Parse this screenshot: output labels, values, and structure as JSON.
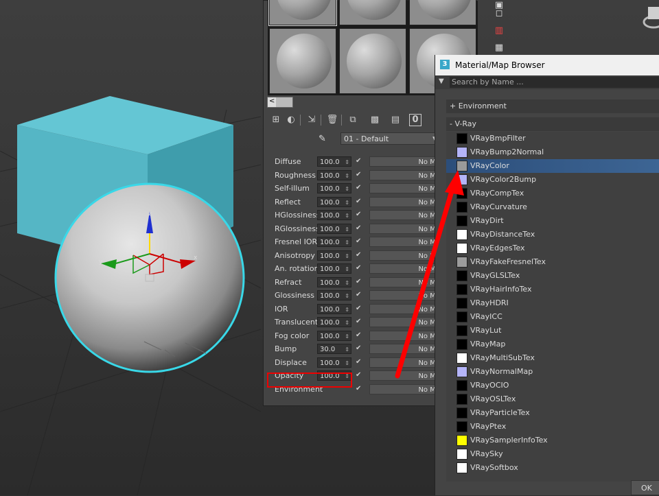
{
  "material_editor": {
    "toolbar_icons": [
      "get-material-icon",
      "put-to-scene-icon",
      "assign-material-icon",
      "delete-icon",
      "make-unique-icon",
      "show-in-viewport-icon",
      "save-icon",
      "material-id-channel-icon"
    ],
    "material_id_channel": "0",
    "nav_left": "<",
    "material_name": "01 - Default",
    "maps": [
      {
        "label": "Diffuse",
        "value": "100.0",
        "slot": "No Ma"
      },
      {
        "label": "Roughness",
        "value": "100.0",
        "slot": "No Ma"
      },
      {
        "label": "Self-illum",
        "value": "100.0",
        "slot": "No Ma"
      },
      {
        "label": "Reflect",
        "value": "100.0",
        "slot": "No Ma"
      },
      {
        "label": "HGlossiness",
        "value": "100.0",
        "slot": "No Ma"
      },
      {
        "label": "RGlossiness",
        "value": "100.0",
        "slot": "No Ma"
      },
      {
        "label": "Fresnel IOR",
        "value": "100.0",
        "slot": "No Ma"
      },
      {
        "label": "Anisotropy",
        "value": "100.0",
        "slot": "No Ma"
      },
      {
        "label": "An. rotation",
        "value": "100.0",
        "slot": "No Ma"
      },
      {
        "label": "Refract",
        "value": "100.0",
        "slot": "No Ma"
      },
      {
        "label": "Glossiness",
        "value": "100.0",
        "slot": "No Ma"
      },
      {
        "label": "IOR",
        "value": "100.0",
        "slot": "No Ma"
      },
      {
        "label": "Translucent",
        "value": "100.0",
        "slot": "No Ma"
      },
      {
        "label": "Fog color",
        "value": "100.0",
        "slot": "No Ma"
      },
      {
        "label": "Bump",
        "value": "30.0",
        "slot": "No Ma"
      },
      {
        "label": "Displace",
        "value": "100.0",
        "slot": "No Ma"
      },
      {
        "label": "Opacity",
        "value": "100.0",
        "slot": "No Ma"
      },
      {
        "label": "Environment",
        "value": "",
        "slot": "No Ma"
      }
    ]
  },
  "browser": {
    "title": "Material/Map Browser",
    "search_placeholder": "Search by Name ...",
    "groups": {
      "environment": "+ Environment",
      "vray": "- V-Ray"
    },
    "items": [
      {
        "name": "VRayBmpFilter",
        "color": "#000000"
      },
      {
        "name": "VRayBump2Normal",
        "color": "#b4b4f8"
      },
      {
        "name": "VRayColor",
        "color": "#9a9a9a"
      },
      {
        "name": "VRayColor2Bump",
        "color": "#b4b4f8"
      },
      {
        "name": "VRayCompTex",
        "color": "#000000"
      },
      {
        "name": "VRayCurvature",
        "color": "#000000"
      },
      {
        "name": "VRayDirt",
        "color": "#000000"
      },
      {
        "name": "VRayDistanceTex",
        "color": "#ffffff"
      },
      {
        "name": "VRayEdgesTex",
        "color": "#ffffff"
      },
      {
        "name": "VRayFakeFresnelTex",
        "color": "#9c9c9c"
      },
      {
        "name": "VRayGLSLTex",
        "color": "#000000"
      },
      {
        "name": "VRayHairInfoTex",
        "color": "#000000"
      },
      {
        "name": "VRayHDRI",
        "color": "#000000"
      },
      {
        "name": "VRayICC",
        "color": "#000000"
      },
      {
        "name": "VRayLut",
        "color": "#000000"
      },
      {
        "name": "VRayMap",
        "color": "#000000"
      },
      {
        "name": "VRayMultiSubTex",
        "color": "#ffffff"
      },
      {
        "name": "VRayNormalMap",
        "color": "#b4b4f8"
      },
      {
        "name": "VRayOCIO",
        "color": "#000000"
      },
      {
        "name": "VRayOSLTex",
        "color": "#000000"
      },
      {
        "name": "VRayParticleTex",
        "color": "#000000"
      },
      {
        "name": "VRayPtex",
        "color": "#000000"
      },
      {
        "name": "VRaySamplerInfoTex",
        "color": "#ffff00"
      },
      {
        "name": "VRaySky",
        "color": "#ffffff"
      },
      {
        "name": "VRaySoftbox",
        "color": "#ffffff"
      }
    ],
    "selected_item": "VRayColor",
    "ok_label": "OK"
  },
  "gizmo_labels": {
    "z": "z",
    "x": "x",
    "y": "y"
  },
  "annotation_color": "#ff0000"
}
